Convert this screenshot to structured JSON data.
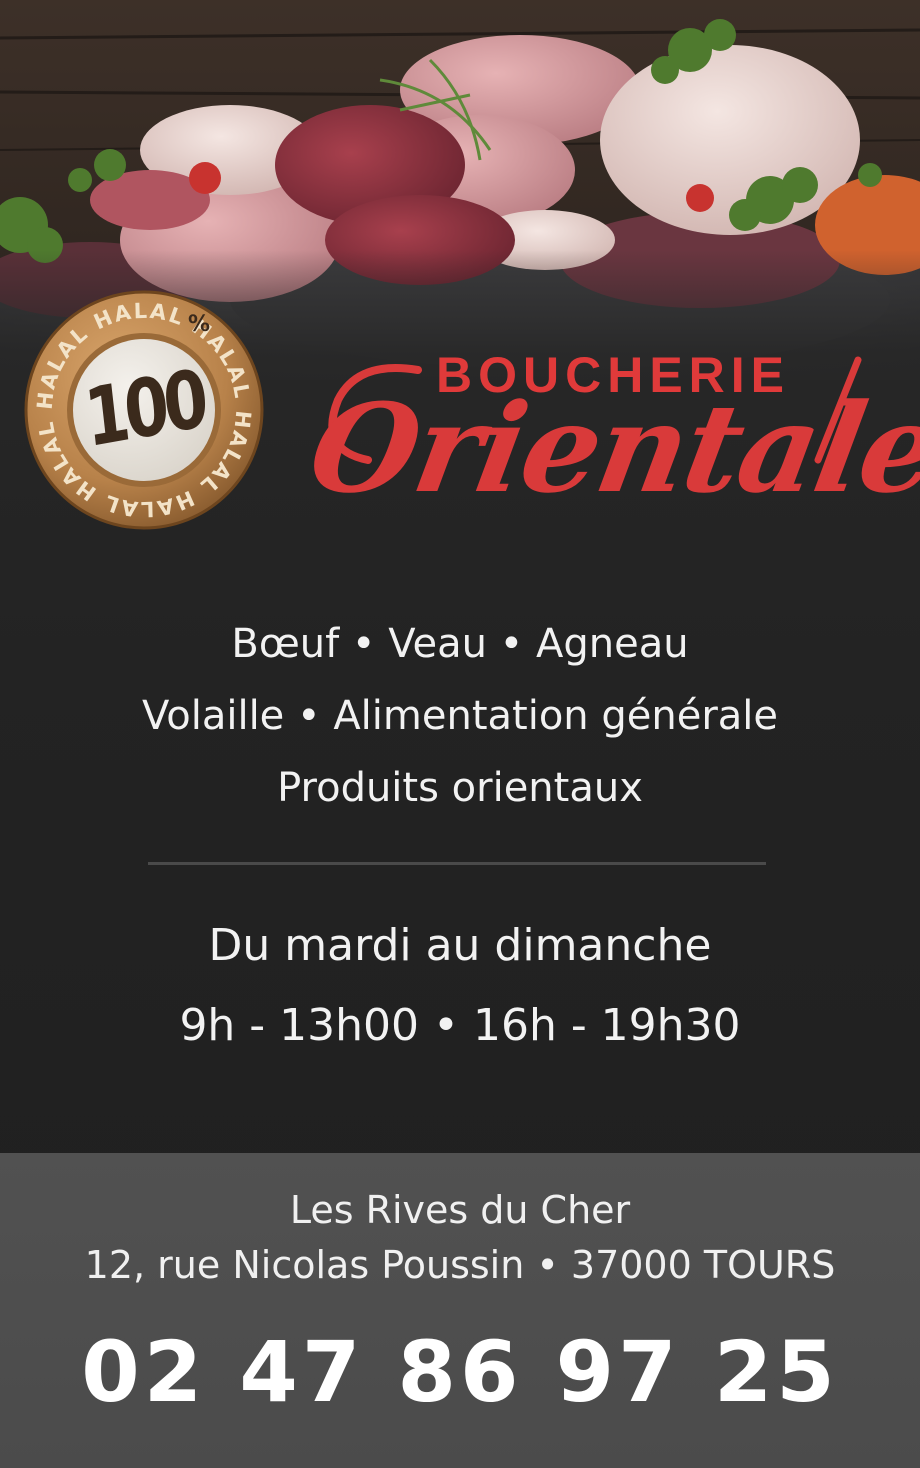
{
  "badge": {
    "number": "100",
    "percent": "%",
    "ring_text": "HALAL  HALAL  HALAL  HALAL  HALAL  HALAL  HALAL  HALAL"
  },
  "logo": {
    "top": "BOUCHERIE",
    "script": "Orientale"
  },
  "products": {
    "line1": "Bœuf • Veau • Agneau",
    "line2": "Volaille • Alimentation générale",
    "line3": "Produits orientaux"
  },
  "hours": {
    "days": "Du mardi au dimanche",
    "times": "9h - 13h00 • 16h - 19h30"
  },
  "address": {
    "line1": "Les Rives du Cher",
    "line2": "12, rue Nicolas Poussin • 37000 TOURS"
  },
  "phone": "02 47 86 97 25",
  "colors": {
    "logo_red": "#d93a3a",
    "background": "#232323",
    "footer_band": "#4d4d4d",
    "badge_gold": "#b8824a"
  }
}
